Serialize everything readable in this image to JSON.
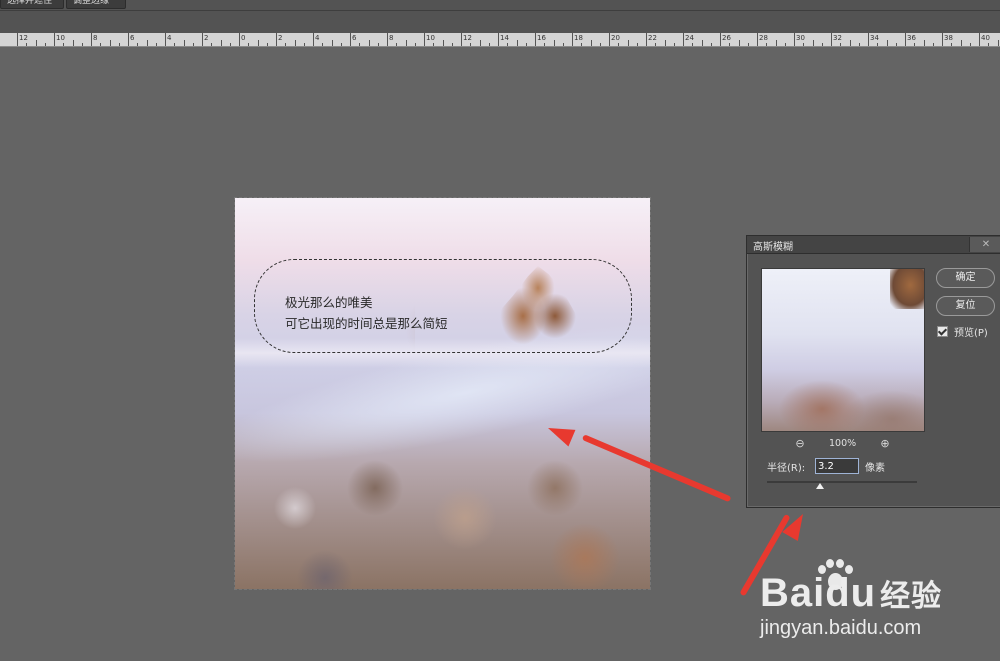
{
  "toolbar": {
    "btn1": "选择并遮住",
    "btn2": "调整边缘"
  },
  "ruler": {
    "labels": [
      "12",
      "10",
      "8",
      "6",
      "4",
      "2",
      "0",
      "2",
      "4",
      "6",
      "8",
      "10",
      "12",
      "14",
      "16",
      "18",
      "20",
      "22",
      "24",
      "26",
      "28",
      "30",
      "32",
      "34",
      "36",
      "38",
      "40"
    ]
  },
  "canvas": {
    "caption_line1": "极光那么的唯美",
    "caption_line2": "可它出现的时间总是那么简短"
  },
  "dialog": {
    "title": "高斯模糊",
    "close": "✕",
    "ok": "确定",
    "reset": "复位",
    "preview_label": "预览(P)",
    "preview_checked": true,
    "zoom_out": "⊖",
    "zoom_in": "⊕",
    "zoom_pct": "100%",
    "radius_label": "半径(R):",
    "radius_value": "3.2",
    "radius_unit": "像素"
  },
  "watermark": {
    "brand": "Baidu",
    "brand_cn": "经验",
    "url": "jingyan.baidu.com"
  },
  "colors": {
    "arrow": "#e8392f",
    "background": "#646464",
    "dialog": "#535353"
  }
}
